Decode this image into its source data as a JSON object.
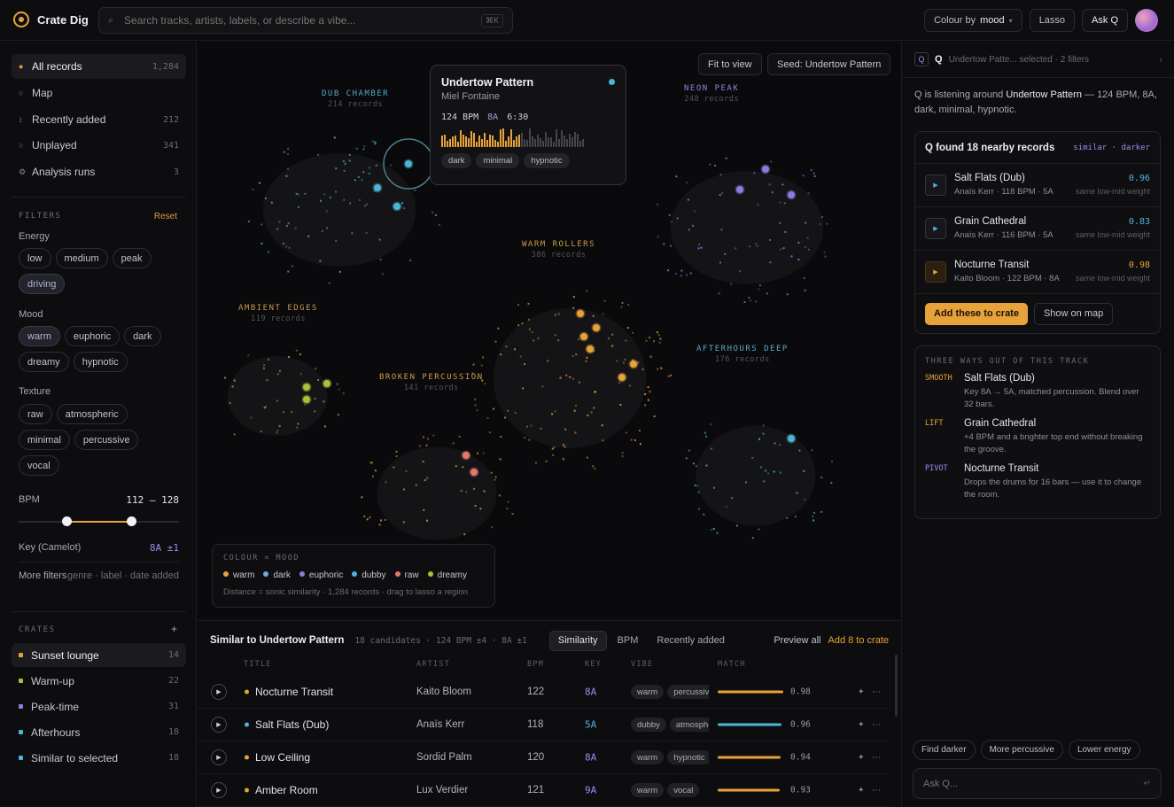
{
  "app": {
    "name": "Crate Dig"
  },
  "search": {
    "placeholder": "Search tracks, artists, labels, or describe a vibe...",
    "shortcut": "⌘K"
  },
  "topbar": {
    "colour_by_label": "Colour by",
    "colour_by_value": "mood",
    "lasso": "Lasso",
    "ask": "Ask Q"
  },
  "nav": [
    {
      "label": "All records",
      "count": "1,284",
      "icon": "dot-icon"
    },
    {
      "label": "Map",
      "count": "",
      "icon": "circle-icon"
    },
    {
      "label": "Recently added",
      "count": "212",
      "icon": "sort-icon"
    },
    {
      "label": "Unplayed",
      "count": "341",
      "icon": "circle-icon"
    },
    {
      "label": "Analysis runs",
      "count": "3",
      "icon": "gear-icon"
    }
  ],
  "filters": {
    "title": "FILTERS",
    "reset": "Reset",
    "energy": {
      "label": "Energy",
      "options": [
        "low",
        "medium",
        "peak",
        "driving"
      ],
      "selected": [
        "driving"
      ]
    },
    "mood": {
      "label": "Mood",
      "options": [
        "warm",
        "euphoric",
        "dark",
        "dreamy",
        "hypnotic"
      ],
      "selected": [
        "warm"
      ]
    },
    "texture": {
      "label": "Texture",
      "options": [
        "raw",
        "atmospheric",
        "minimal",
        "percussive",
        "vocal"
      ],
      "selected": []
    },
    "bpm": {
      "label": "BPM",
      "value": "112 – 128",
      "min": 112,
      "max": 128,
      "range_min": 100,
      "range_max": 140
    },
    "key": {
      "label": "Key (Camelot)",
      "value": "8A ±1"
    },
    "more": {
      "label": "More filters",
      "value": "genre · label · date added"
    }
  },
  "crates": {
    "title": "CRATES",
    "add": "+",
    "items": [
      {
        "label": "Sunset lounge",
        "count": "14",
        "color": "#e8a23a"
      },
      {
        "label": "Warm-up",
        "count": "22",
        "color": "#9fbf4a"
      },
      {
        "label": "Peak-time",
        "count": "31",
        "color": "#8f7be0"
      },
      {
        "label": "Afterhours",
        "count": "18",
        "color": "#4cb6d8"
      },
      {
        "label": "Similar to selected",
        "count": "18",
        "color": "#4cb6d8"
      }
    ]
  },
  "map": {
    "fit_to_view": "Fit to view",
    "seed": "Seed: Undertow Pattern",
    "clusters": [
      {
        "name": "DUB CHAMBER",
        "count": "214 records",
        "color": "#5aa8c8"
      },
      {
        "name": "NEON PEAK",
        "count": "248 records",
        "color": "#8f86d8"
      },
      {
        "name": "WARM ROLLERS",
        "count": "386 records",
        "color": "#d19a45"
      },
      {
        "name": "AMBIENT EDGES",
        "count": "119 records",
        "color": "#c49a4a"
      },
      {
        "name": "BROKEN PERCUSSION",
        "count": "141 records",
        "color": "#d19a45"
      },
      {
        "name": "AFTERHOURS DEEP",
        "count": "176 records",
        "color": "#5aa8c8"
      }
    ],
    "tooltip": {
      "title": "Undertow Pattern",
      "artist": "Miel Fontaine",
      "bpm": "124 BPM",
      "key": "8A",
      "duration": "6:30",
      "tags": [
        "dark",
        "minimal",
        "hypnotic"
      ],
      "wave_played_fraction": 0.55
    },
    "legend": {
      "title": "COLOUR = MOOD",
      "items": [
        {
          "label": "warm",
          "color": "#e8a23a"
        },
        {
          "label": "dark",
          "color": "#6fa8dc"
        },
        {
          "label": "euphoric",
          "color": "#8f7be0"
        },
        {
          "label": "dubby",
          "color": "#4cb6d8"
        },
        {
          "label": "raw",
          "color": "#e07a6a"
        },
        {
          "label": "dreamy",
          "color": "#a8c23a"
        }
      ],
      "note": "Distance = sonic similarity · 1,284 records · drag to lasso a region"
    }
  },
  "similar": {
    "title": "Similar to Undertow Pattern",
    "meta": "18 candidates · 124 BPM ±4 · 8A ±1",
    "sort": [
      "Similarity",
      "BPM",
      "Recently added"
    ],
    "sort_selected": "Similarity",
    "preview_all": "Preview all",
    "add_to_crate": "Add 8 to crate",
    "columns": [
      "TITLE",
      "ARTIST",
      "BPM",
      "KEY",
      "VIBE",
      "MATCH"
    ],
    "rows": [
      {
        "title": "Nocturne Transit",
        "artist": "Kaito Bloom",
        "bpm": "122",
        "key": "8A",
        "vibe": [
          "warm",
          "percussive"
        ],
        "match": 0.98,
        "match_label": "0.98",
        "color": "#e8a23a"
      },
      {
        "title": "Salt Flats (Dub)",
        "artist": "Anaïs Kerr",
        "bpm": "118",
        "key": "5A",
        "vibe": [
          "dubby",
          "atmospheric"
        ],
        "match": 0.96,
        "match_label": "0.96",
        "color": "#4cb6d8"
      },
      {
        "title": "Low Ceiling",
        "artist": "Sordid Palm",
        "bpm": "120",
        "key": "8A",
        "vibe": [
          "warm",
          "hypnotic"
        ],
        "match": 0.94,
        "match_label": "0.94",
        "color": "#e8a23a"
      },
      {
        "title": "Amber Room",
        "artist": "Lux Verdier",
        "bpm": "121",
        "key": "9A",
        "vibe": [
          "warm",
          "vocal"
        ],
        "match": 0.93,
        "match_label": "0.93",
        "color": "#e8a23a"
      }
    ]
  },
  "q": {
    "context": "Undertow Patte... selected · 2 filters",
    "intro_prefix": "Q is listening around ",
    "intro_track": "Undertow Pattern",
    "intro_suffix": " — 124 BPM, 8A, dark, minimal, hypnotic.",
    "found_title": "Q found 18 nearby records",
    "found_tags": "similar · darker",
    "records": [
      {
        "title": "Salt Flats (Dub)",
        "sub": "Anaïs Kerr · 118 BPM · 5A",
        "score": "0.96",
        "why": "same low-mid weight",
        "color": "#4cb6d8"
      },
      {
        "title": "Grain Cathedral",
        "sub": "Anaïs Kerr · 116 BPM · 5A",
        "score": "0.83",
        "why": "same low-mid weight",
        "color": "#4cb6d8"
      },
      {
        "title": "Nocturne Transit",
        "sub": "Kaito Bloom · 122 BPM · 8A",
        "score": "0.98",
        "why": "same low-mid weight",
        "color": "#e8a23a"
      }
    ],
    "add_btn": "Add these to crate",
    "show_btn": "Show on map",
    "ways_title": "THREE WAYS OUT OF THIS TRACK",
    "ways": [
      {
        "label": "SMOOTH",
        "title": "Salt Flats (Dub)",
        "desc": "Key 8A → 5A, matched percussion. Blend over 32 bars.",
        "color": "#e8a23a"
      },
      {
        "label": "LIFT",
        "title": "Grain Cathedral",
        "desc": "+4 BPM and a brighter top end without breaking the groove.",
        "color": "#e8a23a"
      },
      {
        "label": "PIVOT",
        "title": "Nocturne Transit",
        "desc": "Drops the drums for 16 bars — use it to change the room.",
        "color": "#9c8cf0"
      }
    ],
    "quick": [
      "Find darker",
      "More percussive",
      "Lower energy"
    ],
    "ask_placeholder": "Ask Q..."
  }
}
